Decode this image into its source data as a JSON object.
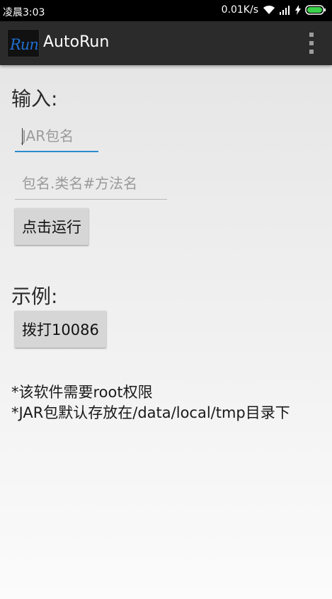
{
  "status_bar": {
    "time": "凌晨3:03",
    "net_speed": "0.01K/s",
    "icons": [
      "wifi-icon",
      "signal-icon",
      "charging-icon",
      "battery-icon"
    ]
  },
  "app_bar": {
    "logo_text": "Run",
    "title": "AutoRun",
    "menu_icon": "overflow-menu-icon"
  },
  "form": {
    "input_label": "输入:",
    "jar_placeholder": "JAR包名",
    "method_placeholder": "包名.类名#方法名",
    "run_button": "点击运行"
  },
  "example": {
    "label": "示例:",
    "dial_button": "拨打10086"
  },
  "notes": [
    "*该软件需要root权限",
    "*JAR包默认存放在/data/local/tmp目录下"
  ],
  "colors": {
    "accent": "#2a8bd0",
    "app_bar": "#2b2b2b",
    "button": "#d6d6d6"
  }
}
